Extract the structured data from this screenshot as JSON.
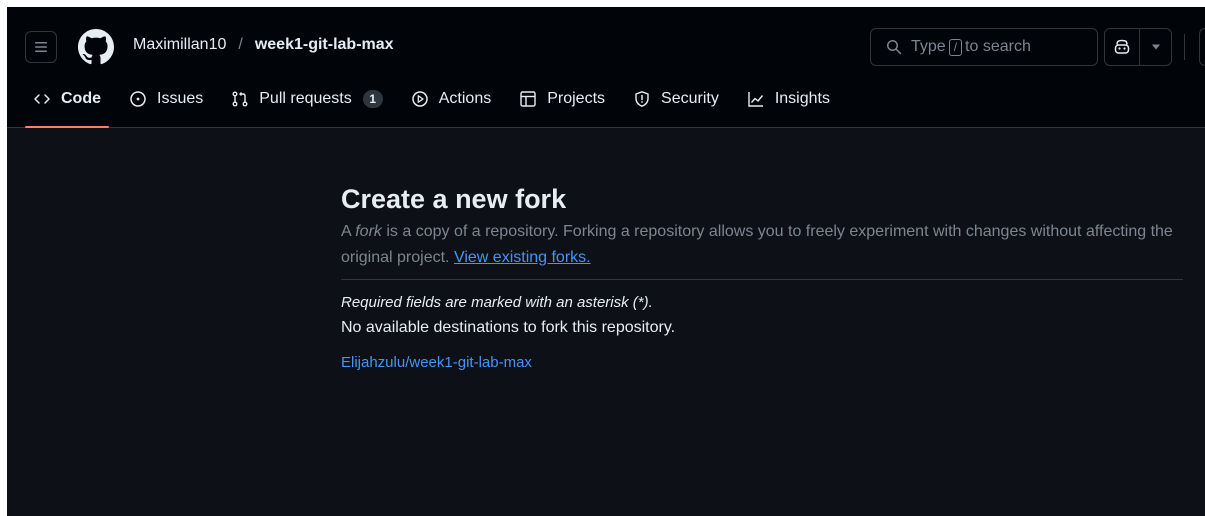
{
  "header": {
    "owner": "Maximillan10",
    "separator": "/",
    "repo": "week1-git-lab-max",
    "search": {
      "prefix": "Type",
      "key": "/",
      "suffix": "to search"
    },
    "icons": {
      "menu": "hamburger-menu-icon",
      "logo": "github-logo-icon",
      "search": "search-icon",
      "copilot": "copilot-icon",
      "caret": "triangle-down-icon"
    }
  },
  "tabs": [
    {
      "label": "Code",
      "icon": "code-icon",
      "active": true
    },
    {
      "label": "Issues",
      "icon": "issue-opened-icon"
    },
    {
      "label": "Pull requests",
      "icon": "git-pull-request-icon",
      "count": "1"
    },
    {
      "label": "Actions",
      "icon": "play-icon"
    },
    {
      "label": "Projects",
      "icon": "table-icon"
    },
    {
      "label": "Security",
      "icon": "shield-icon"
    },
    {
      "label": "Insights",
      "icon": "graph-icon"
    }
  ],
  "main": {
    "title": "Create a new fork",
    "desc_prefix": "A ",
    "desc_em": "fork",
    "desc_body": " is a copy of a repository. Forking a repository allows you to freely experiment with changes without affecting the original project. ",
    "desc_link": "View existing forks.",
    "required": "Required fields are marked with an asterisk (*).",
    "no_destinations": "No available destinations to fork this repository.",
    "existing_fork": "Elijahzulu/week1-git-lab-max"
  },
  "colors": {
    "page_bg": "#0d1117",
    "header_bg": "#010409",
    "text": "#e6edf3",
    "muted": "#7d8590",
    "link": "#4493f8",
    "active_tab_underline": "#f78166",
    "border": "#30363d"
  }
}
